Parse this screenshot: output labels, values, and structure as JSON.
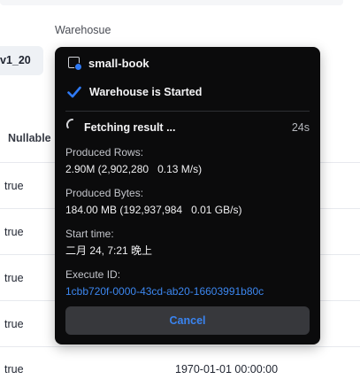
{
  "background": {
    "warehouse_label": "Warehosue",
    "version_chip": "v1_20",
    "column_header": "Nullable",
    "rows": [
      {
        "nullable": "true",
        "default": ""
      },
      {
        "nullable": "true",
        "default": ""
      },
      {
        "nullable": "true",
        "default": ""
      },
      {
        "nullable": "true",
        "default": ""
      },
      {
        "nullable": "true",
        "default": "1970-01-01 00:00:00"
      }
    ]
  },
  "popover": {
    "warehouse_name": "small-book",
    "warehouse_icon": "warehouse-icon",
    "status_icon": "check-icon",
    "status_text": "Warehouse is Started",
    "progress_icon": "spinner-icon",
    "fetch_text": "Fetching result ...",
    "elapsed": "24s",
    "produced_rows_label": "Produced Rows:",
    "produced_rows_value": "2.90M (2,902,280   0.13 M/s)",
    "produced_bytes_label": "Produced Bytes:",
    "produced_bytes_value": "184.00 MB (192,937,984   0.01 GB/s)",
    "start_time_label": "Start time:",
    "start_time_value": "二月 24, 7:21 晚上",
    "execute_id_label": "Execute ID:",
    "execute_id_value": "1cbb720f-0000-43cd-ab20-16603991b80c",
    "cancel_label": "Cancel"
  },
  "colors": {
    "popover_bg": "#0b0b0c",
    "accent_blue": "#3a84f0",
    "cancel_bg": "#37383c"
  }
}
